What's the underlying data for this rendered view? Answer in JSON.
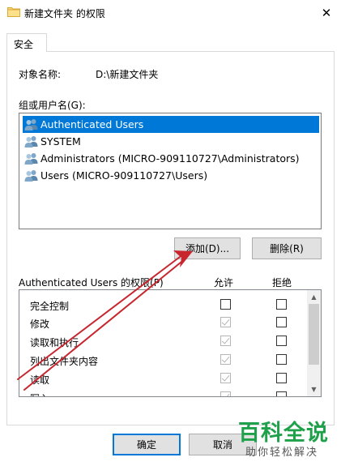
{
  "window": {
    "title": "新建文件夹 的权限",
    "close_glyph": "✕"
  },
  "tabs": [
    {
      "label": "安全"
    }
  ],
  "object": {
    "label": "对象名称:",
    "value": "D:\\新建文件夹"
  },
  "group": {
    "label": "组或用户名(G):",
    "users": [
      {
        "name": "Authenticated Users",
        "selected": true
      },
      {
        "name": "SYSTEM",
        "selected": false
      },
      {
        "name": "Administrators (MICRO-909110727\\Administrators)",
        "selected": false
      },
      {
        "name": "Users (MICRO-909110727\\Users)",
        "selected": false
      }
    ]
  },
  "buttons": {
    "add": "添加(D)...",
    "remove": "删除(R)",
    "ok": "确定",
    "cancel": "取消"
  },
  "permissions": {
    "label": "Authenticated Users 的权限(P)",
    "allow_header": "允许",
    "deny_header": "拒绝",
    "rows": [
      {
        "name": "完全控制",
        "allow": "unchecked",
        "deny": "unchecked"
      },
      {
        "name": "修改",
        "allow": "checked-disabled",
        "deny": "unchecked"
      },
      {
        "name": "读取和执行",
        "allow": "checked-disabled",
        "deny": "unchecked"
      },
      {
        "name": "列出文件夹内容",
        "allow": "checked-disabled",
        "deny": "unchecked"
      },
      {
        "name": "读取",
        "allow": "checked-disabled",
        "deny": "unchecked"
      },
      {
        "name": "写入",
        "allow": "checked-disabled",
        "deny": "unchecked"
      }
    ]
  },
  "watermark": {
    "title": "百科全说",
    "subtitle": "助你轻松解决"
  },
  "colors": {
    "selection": "#0078d7",
    "annotation_arrow": "#c8262e",
    "watermark_green": "#1fa04a"
  }
}
